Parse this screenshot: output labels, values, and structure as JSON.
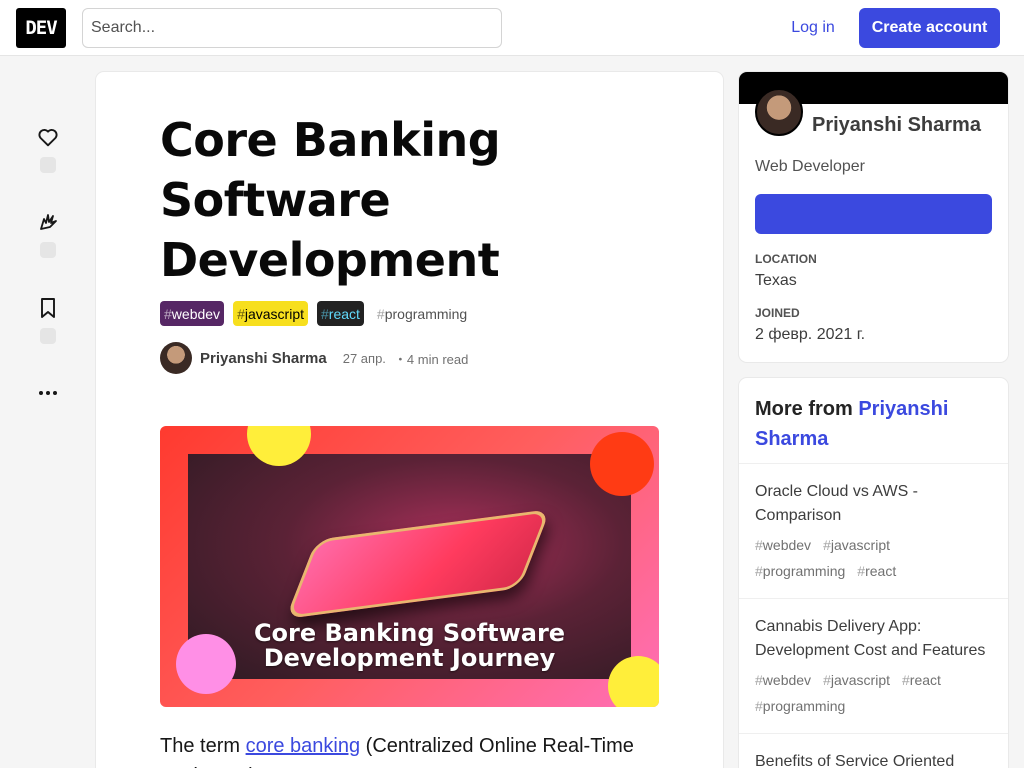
{
  "header": {
    "logo": "DEV",
    "search_placeholder": "Search...",
    "login_label": "Log in",
    "create_account_label": "Create account"
  },
  "rail": {
    "icons": [
      "heart-icon",
      "unicorn-icon",
      "bookmark-icon",
      "more-horizontal-icon"
    ]
  },
  "article": {
    "title": "Core Banking Software Development",
    "tags": [
      {
        "name": "webdev",
        "bg": "#562765",
        "fg": "#ffffff"
      },
      {
        "name": "javascript",
        "bg": "#f7df1e",
        "fg": "#000000"
      },
      {
        "name": "react",
        "bg": "#222222",
        "fg": "#61dafb"
      },
      {
        "name": "programming",
        "bg": "transparent",
        "fg": "#525252"
      }
    ],
    "author": "Priyanshi Sharma",
    "date": "27 апр.",
    "read_time": "・4 min read",
    "cover": {
      "line1": "Core Banking Software",
      "line2": "Development Journey"
    },
    "body": {
      "prefix": "The term ",
      "link": "core banking",
      "suffix": " (Centralized Online Real-Time Exchange) "
    }
  },
  "profile": {
    "name": "Priyanshi Sharma",
    "role": "Web Developer",
    "location_label": "LOCATION",
    "location": "Texas",
    "joined_label": "JOINED",
    "joined": "2 февр. 2021 г."
  },
  "more_from": {
    "prefix": "More from ",
    "author": "Priyanshi Sharma",
    "items": [
      {
        "title": "Oracle Cloud vs AWS - Comparison",
        "tags": [
          "webdev",
          "javascript",
          "programming",
          "react"
        ]
      },
      {
        "title": "Cannabis Delivery App: Development Cost and Features",
        "tags": [
          "webdev",
          "javascript",
          "react",
          "programming"
        ]
      },
      {
        "title": "Benefits of Service Oriented",
        "tags": []
      }
    ]
  },
  "colors": {
    "accent": "#3b49df",
    "header_bg": "#ffffff",
    "page_bg": "#f5f5f5"
  }
}
